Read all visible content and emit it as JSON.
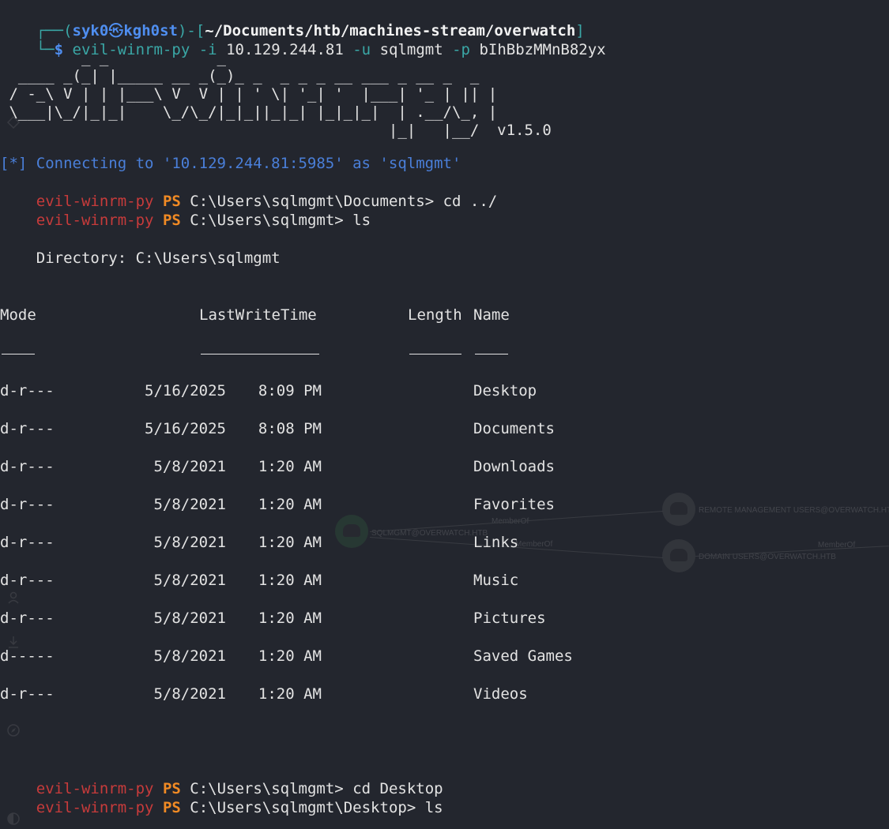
{
  "prompt": {
    "frame_top": "┌──(",
    "user": "syk0",
    "skull": "㉿",
    "host": "kgh0st",
    "mid": ")-[",
    "path": "~/Documents/htb/machines-stream/overwatch",
    "end": "]",
    "frame_bottom": "└─",
    "dollar": "$ ",
    "cmd": "evil-winrm-py",
    "flag_i": "-i",
    "ip": "10.129.244.81",
    "flag_u": "-u",
    "user_arg": "sqlmgmt",
    "flag_p": "-p",
    "pass_arg": "bIhBbzMMnB82yx"
  },
  "banner": {
    "art": "         _ _            _\n  ____ _(_| |_____ __ _(_)_ _  _ _ _ __ ___ _ __ _  _\n / -_\\ V | | |___\\ V  V | | ' \\| '_| '  |___| '_ | || |\n \\___|\\_/|_|_|    \\_/\\_/|_|_||_|_| |_|_|_|  | .__/\\_, |\n                                           |_|   |__/  v1.5.0"
  },
  "info_line": "[*] Connecting to '10.129.244.81:5985' as 'sqlmgmt'",
  "ps_lines": [
    {
      "prefix": "evil-winrm-py",
      "ps": "PS",
      "path": "C:\\Users\\sqlmgmt\\Documents>",
      "cmd": "cd ../"
    },
    {
      "prefix": "evil-winrm-py",
      "ps": "PS",
      "path": "C:\\Users\\sqlmgmt>",
      "cmd": "ls"
    }
  ],
  "directory_label": "    Directory: C:\\Users\\sqlmgmt",
  "listing": {
    "headers": {
      "mode": "Mode",
      "lastwrite": "LastWriteTime",
      "length": "Length",
      "name": "Name"
    },
    "rows": [
      {
        "mode": "d-r---",
        "date": "5/16/2025",
        "time": "8:09 PM",
        "name": "Desktop"
      },
      {
        "mode": "d-r---",
        "date": "5/16/2025",
        "time": "8:08 PM",
        "name": "Documents"
      },
      {
        "mode": "d-r---",
        "date": "5/8/2021",
        "time": "1:20 AM",
        "name": "Downloads"
      },
      {
        "mode": "d-r---",
        "date": "5/8/2021",
        "time": "1:20 AM",
        "name": "Favorites"
      },
      {
        "mode": "d-r---",
        "date": "5/8/2021",
        "time": "1:20 AM",
        "name": "Links"
      },
      {
        "mode": "d-r---",
        "date": "5/8/2021",
        "time": "1:20 AM",
        "name": "Music"
      },
      {
        "mode": "d-r---",
        "date": "5/8/2021",
        "time": "1:20 AM",
        "name": "Pictures"
      },
      {
        "mode": "d-----",
        "date": "5/8/2021",
        "time": "1:20 AM",
        "name": "Saved Games"
      },
      {
        "mode": "d-r---",
        "date": "5/8/2021",
        "time": "1:20 AM",
        "name": "Videos"
      }
    ]
  },
  "final_lines": [
    {
      "prefix": "evil-winrm-py",
      "ps": "PS",
      "path": "C:\\Users\\sqlmgmt>",
      "cmd": "cd Desktop"
    },
    {
      "prefix": "evil-winrm-py",
      "ps": "PS",
      "path": "C:\\Users\\sqlmgmt\\Desktop>",
      "cmd": "ls"
    }
  ],
  "ghost": {
    "node_center": "SQLMGMT@OVERWATCH.HTB",
    "node_top": "REMOTE MANAGEMENT USERS@OVERWATCH.HTB",
    "node_bottom": "DOMAIN USERS@OVERWATCH.HTB",
    "edge_label_1": "MemberOf",
    "edge_label_2": "MemberOf",
    "edge_label_3": "MemberOf"
  }
}
